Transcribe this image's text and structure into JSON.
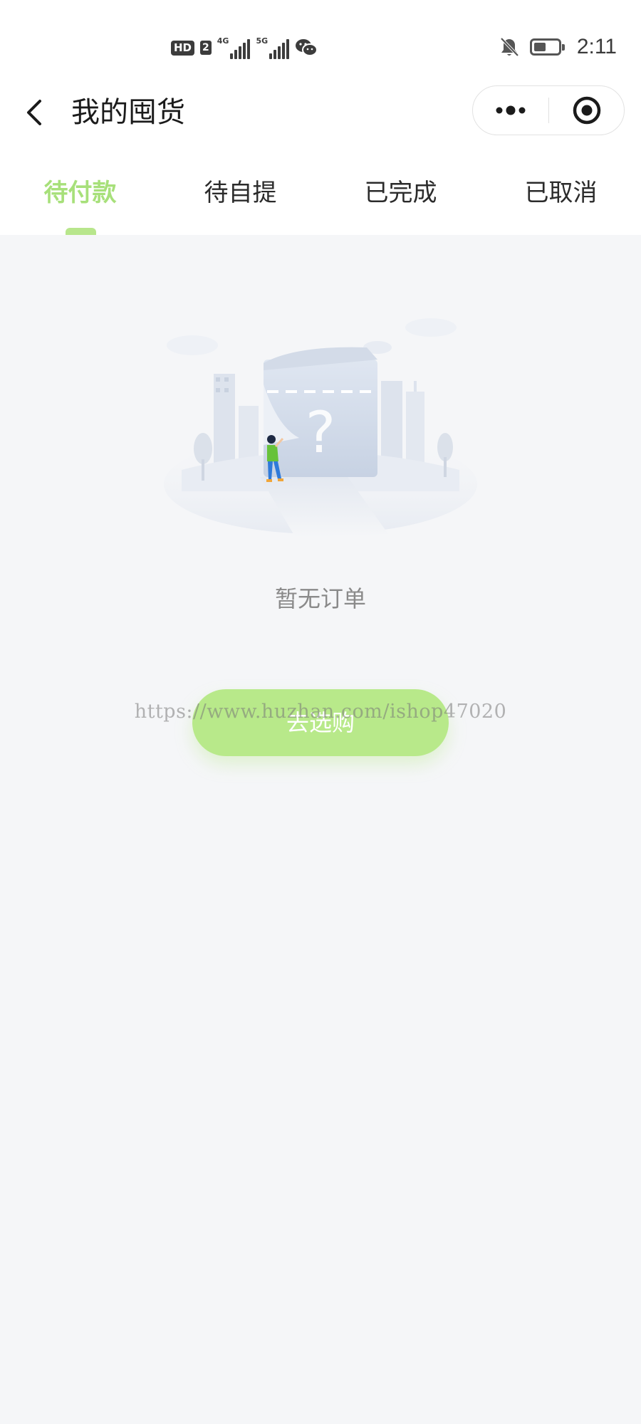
{
  "status_bar": {
    "hd_label": "HD",
    "sim_label": "2",
    "network_1": "4G",
    "network_2": "5G",
    "time": "2:11"
  },
  "nav": {
    "title": "我的囤货"
  },
  "tabs": [
    {
      "label": "待付款",
      "active": true
    },
    {
      "label": "待自提",
      "active": false
    },
    {
      "label": "已完成",
      "active": false
    },
    {
      "label": "已取消",
      "active": false
    }
  ],
  "empty_state": {
    "message": "暂无订单",
    "button_label": "去选购"
  },
  "watermark": "https://www.huzhan.com/ishop47020",
  "colors": {
    "accent": "#a7e07a",
    "button_bg": "#b8e98a",
    "page_bg": "#f5f6f8"
  },
  "icons": {
    "back": "chevron-left-icon",
    "more": "more-dots-icon",
    "close": "target-circle-icon",
    "mute": "bell-off-icon",
    "wechat": "wechat-icon",
    "battery": "battery-icon"
  }
}
